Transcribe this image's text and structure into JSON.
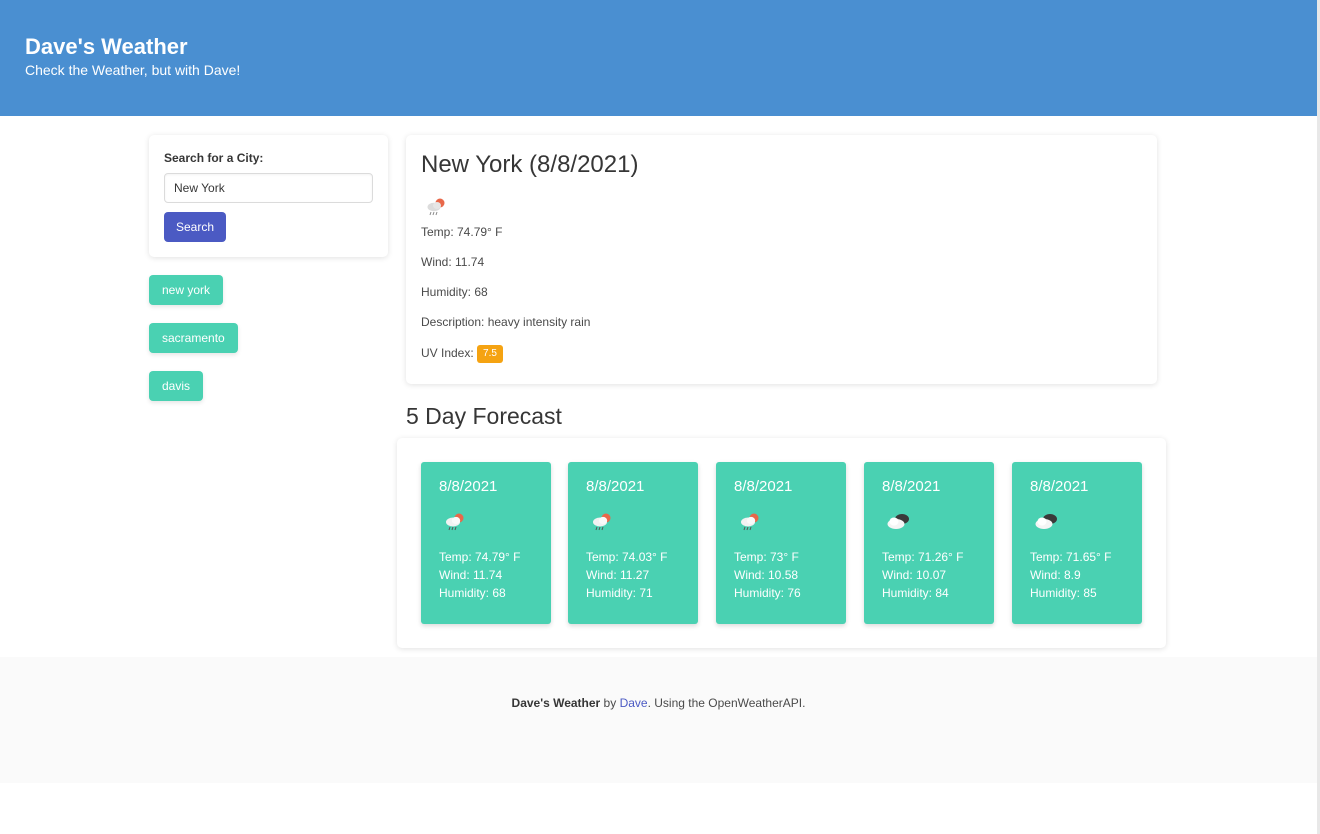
{
  "header": {
    "title": "Dave's Weather",
    "subtitle": "Check the Weather, but with Dave!"
  },
  "search": {
    "label": "Search for a City:",
    "value": "New York",
    "button": "Search"
  },
  "history": [
    "new york",
    "sacramento",
    "davis"
  ],
  "current": {
    "heading": "New York (8/8/2021)",
    "icon": "rain-sun-icon",
    "temp": "Temp: 74.79° F",
    "wind": "Wind: 11.74",
    "humidity": "Humidity: 68",
    "description": "Description: heavy intensity rain",
    "uv_label": "UV Index:",
    "uv_value": "7.5",
    "uv_color": "#f5a312"
  },
  "forecast_title": "5 Day Forecast",
  "forecast": [
    {
      "date": "8/8/2021",
      "icon": "rain-sun-icon",
      "temp": "Temp: 74.79° F",
      "wind": "Wind: 11.74",
      "humidity": "Humidity: 68"
    },
    {
      "date": "8/8/2021",
      "icon": "rain-sun-icon",
      "temp": "Temp: 74.03° F",
      "wind": "Wind: 11.27",
      "humidity": "Humidity: 71"
    },
    {
      "date": "8/8/2021",
      "icon": "rain-sun-icon",
      "temp": "Temp: 73° F",
      "wind": "Wind: 10.58",
      "humidity": "Humidity: 76"
    },
    {
      "date": "8/8/2021",
      "icon": "broken-clouds-icon",
      "temp": "Temp: 71.26° F",
      "wind": "Wind: 10.07",
      "humidity": "Humidity: 84"
    },
    {
      "date": "8/8/2021",
      "icon": "broken-clouds-icon",
      "temp": "Temp: 71.65° F",
      "wind": "Wind: 8.9",
      "humidity": "Humidity: 85"
    }
  ],
  "footer": {
    "brand": "Dave's Weather",
    "by": " by ",
    "author": "Dave",
    "rest": ". Using the OpenWeatherAPI."
  },
  "colors": {
    "header": "#4a8fd1",
    "accent": "#4ad1b2",
    "button": "#4b5ac3"
  }
}
